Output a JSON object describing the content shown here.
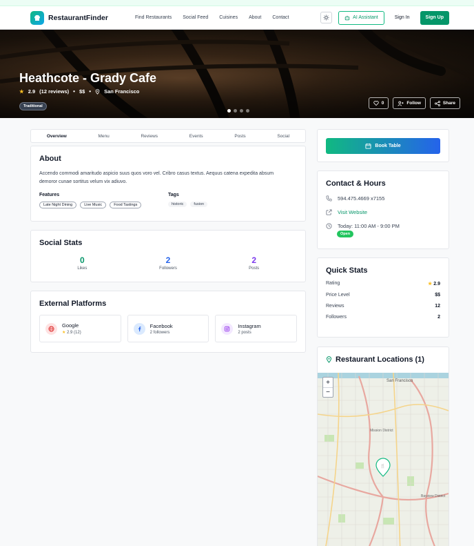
{
  "nav": {
    "brand": "RestaurantFinder",
    "links": [
      "Find Restaurants",
      "Social Feed",
      "Cuisines",
      "About",
      "Contact"
    ],
    "ai_label": "AI Assistant",
    "signin_label": "Sign In",
    "signup_label": "Sign Up"
  },
  "hero": {
    "name": "Heathcote - Grady Cafe",
    "rating": "2.9",
    "reviews": "(12 reviews)",
    "price": "$$",
    "city": "San Francisco",
    "tag": "Traditional",
    "like_count": "0",
    "follow_label": "Follow",
    "share_label": "Share",
    "slides": 4,
    "active_slide": 1
  },
  "tabs": [
    "Overview",
    "Menu",
    "Reviews",
    "Events",
    "Posts",
    "Social"
  ],
  "about": {
    "title": "About",
    "description": "Accendo commodi amaritudo aspicio suus quos voro vel. Cribro casus textus. Aequus catena expedita absum demoror cunae sortitus velum vix adiuvo.",
    "features_label": "Features",
    "features": [
      "Late Night Dining",
      "Live Music",
      "Food Tastings"
    ],
    "tags_label": "Tags",
    "tags": [
      "historic",
      "fusion"
    ]
  },
  "social_stats": {
    "title": "Social Stats",
    "items": [
      {
        "value": "0",
        "label": "Likes",
        "color": "#059669"
      },
      {
        "value": "2",
        "label": "Followers",
        "color": "#2563eb"
      },
      {
        "value": "2",
        "label": "Posts",
        "color": "#7c3aed"
      }
    ]
  },
  "external": {
    "title": "External Platforms",
    "platforms": [
      {
        "name": "Google",
        "sub": "2.9 (12)",
        "icon": "globe-icon",
        "color": "#dc2626",
        "bg": "#fee2e2"
      },
      {
        "name": "Facebook",
        "sub": "2 followers",
        "icon": "facebook-icon",
        "color": "#2563eb",
        "bg": "#dbeafe"
      },
      {
        "name": "Instagram",
        "sub": "2 posts",
        "icon": "instagram-icon",
        "color": "#9333ea",
        "bg": "#f3e8ff"
      }
    ]
  },
  "book": {
    "label": "Book Table"
  },
  "contact": {
    "title": "Contact & Hours",
    "phone": "594.475.4669 x7155",
    "website": "Visit Website",
    "hours": "Today: 11:00 AM - 9:00 PM",
    "status": "Open"
  },
  "quick": {
    "title": "Quick Stats",
    "rows": [
      {
        "label": "Rating",
        "value": "2.9"
      },
      {
        "label": "Price Level",
        "value": "$$"
      },
      {
        "label": "Reviews",
        "value": "12"
      },
      {
        "label": "Followers",
        "value": "2"
      }
    ]
  },
  "locations": {
    "title": "Restaurant Locations (1)",
    "zoom_in": "+",
    "zoom_out": "−",
    "map_labels": [
      "San Francisco",
      "Mission District",
      "Bayview District"
    ]
  },
  "colors": {
    "brand": "#059669",
    "accent": "#2563eb",
    "star": "#fbbf24"
  }
}
